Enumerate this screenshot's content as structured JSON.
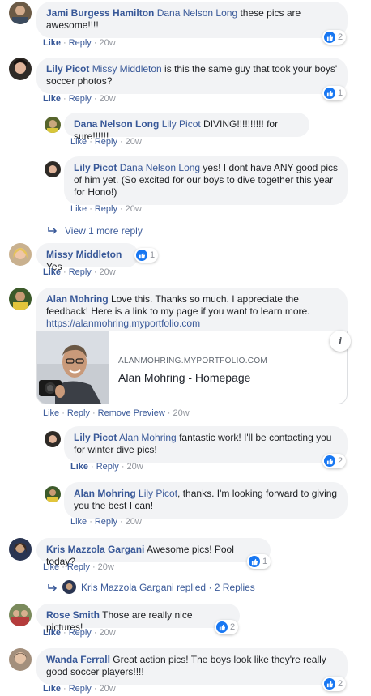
{
  "comments": [
    {
      "name": "Jami Burgess Hamilton",
      "mention": "Dana Nelson Long",
      "text": " these pics are awesome!!!!",
      "like": "Like",
      "reply": "Reply",
      "time": "20w",
      "reactions": "2"
    },
    {
      "name": "Lily Picot",
      "mention": "Missy Middleton",
      "text": " is this the same guy that took your boys' soccer photos?",
      "like": "Like",
      "reply": "Reply",
      "time": "20w",
      "reactions": "1"
    },
    {
      "name": "Dana Nelson Long",
      "mention": "Lily Picot",
      "text": " DIVING!!!!!!!!!! for sure!!!!!!",
      "like": "Like",
      "reply": "Reply",
      "time": "20w"
    },
    {
      "name": "Lily Picot",
      "mention": "Dana Nelson Long",
      "text": " yes! I dont have ANY good pics of him yet. (So excited for our boys to dive together this year for Hono!)",
      "like": "Like",
      "reply": "Reply",
      "time": "20w"
    },
    {
      "name": "Missy Middleton",
      "text": " Yes",
      "like": "Like",
      "reply": "Reply",
      "time": "20w",
      "reactions": "1"
    },
    {
      "name": "Alan Mohring",
      "text": " Love this. Thanks so much. I appreciate the feedback! Here is a link to my page if you want to learn more.",
      "url": "https://alanmohring.myportfolio.com",
      "like": "Like",
      "reply": "Reply",
      "remove": "Remove Preview",
      "time": "20w"
    },
    {
      "name": "Lily Picot",
      "mention": "Alan Mohring",
      "text": " fantastic work! I'll be contacting you for winter dive pics!",
      "like": "Like",
      "reply": "Reply",
      "time": "20w",
      "reactions": "2"
    },
    {
      "name": "Alan Mohring",
      "mention": "Lily Picot",
      "text": ", thanks. I'm looking forward to giving you the best I can!",
      "like": "Like",
      "reply": "Reply",
      "time": "20w"
    },
    {
      "name": "Kris Mazzola Gargani",
      "text": " Awesome pics! Pool today?",
      "like": "Like",
      "reply": "Reply",
      "time": "20w",
      "reactions": "1"
    },
    {
      "name": "Rose Smith",
      "text": " Those are really nice pictures!",
      "like": "Like",
      "reply": "Reply",
      "time": "20w",
      "reactions": "2"
    },
    {
      "name": "Wanda Ferrall",
      "text": " Great action pics! The boys look like they're really good soccer players!!!!",
      "like": "Like",
      "reply": "Reply",
      "time": "20w",
      "reactions": "2"
    }
  ],
  "view_more": "View 1 more reply",
  "replied": {
    "name": "Kris Mazzola Gargani",
    "text": "replied",
    "dot": "·",
    "count": "2 Replies"
  },
  "preview": {
    "domain": "ALANMOHRING.MYPORTFOLIO.COM",
    "title": "Alan Mohring - Homepage",
    "info": "i"
  },
  "colors": {
    "link": "#385898",
    "bubble": "#f2f3f5",
    "like_blue": "#1877f2"
  }
}
